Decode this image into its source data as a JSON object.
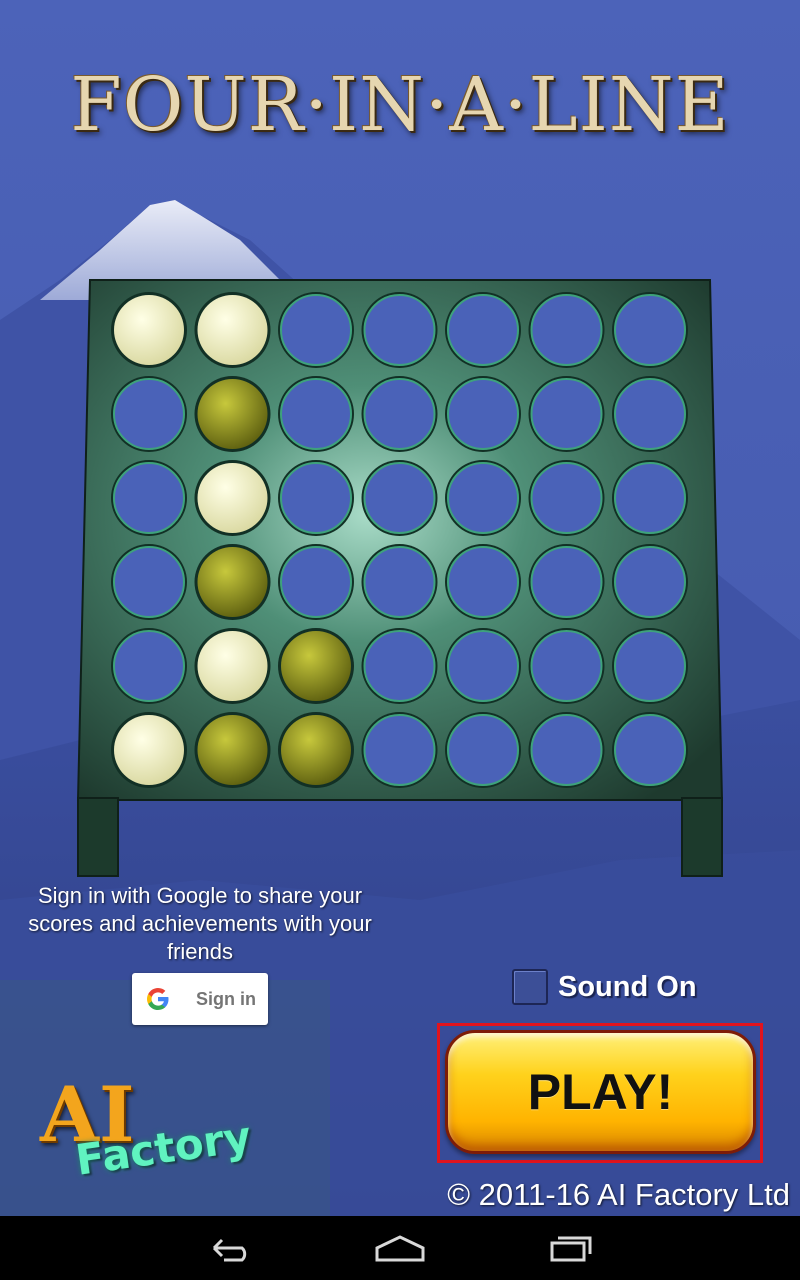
{
  "game": {
    "title": "FOUR·IN·A·LINE",
    "board": {
      "columns": 7,
      "rows": 6,
      "cells": [
        [
          "cream",
          "cream",
          "empty",
          "empty",
          "empty",
          "empty",
          "empty"
        ],
        [
          "empty",
          "green",
          "empty",
          "empty",
          "empty",
          "empty",
          "empty"
        ],
        [
          "empty",
          "cream",
          "empty",
          "empty",
          "empty",
          "empty",
          "empty"
        ],
        [
          "empty",
          "green",
          "empty",
          "empty",
          "empty",
          "empty",
          "empty"
        ],
        [
          "empty",
          "cream",
          "green",
          "empty",
          "empty",
          "empty",
          "empty"
        ],
        [
          "cream",
          "green",
          "green",
          "empty",
          "empty",
          "empty",
          "empty"
        ]
      ]
    }
  },
  "signin": {
    "message": "Sign in with Google to share your scores and achievements with your friends",
    "button_label": "Sign in",
    "icon": "google-g-icon"
  },
  "sound": {
    "label": "Sound On",
    "checked": false
  },
  "play": {
    "label": "PLAY!"
  },
  "branding": {
    "logo_ai": "AI",
    "logo_factory": "Factory",
    "copyright": "© 2011-16 AI Factory Ltd"
  },
  "navbar": {
    "icons": [
      "back-icon",
      "home-icon",
      "recents-icon"
    ]
  },
  "colors": {
    "sky": "#4a61b6",
    "board": "#2f5a45",
    "play_button": "#ffd21c",
    "highlight_frame": "#e0141e",
    "piece_cream": "#f4f3c3",
    "piece_green": "#a3a41a"
  }
}
